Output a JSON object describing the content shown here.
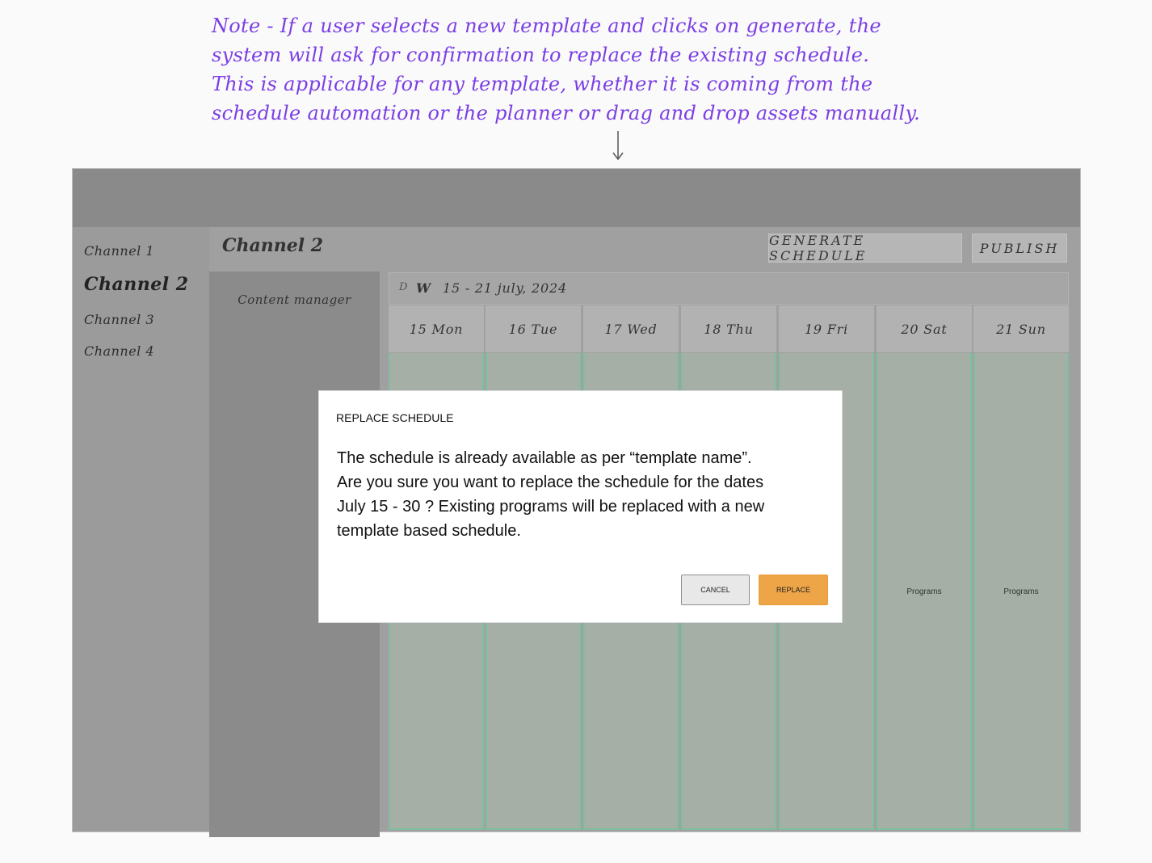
{
  "note": {
    "lines": [
      "Note - If a user selects a new template and clicks on generate, the",
      "system will ask for confirmation to replace the existing schedule.",
      "This is applicable for any template, whether it is coming from the",
      "schedule automation or the planner or drag and drop assets manually."
    ],
    "color": "#7b3fe4"
  },
  "sidebar": {
    "channels": [
      "Channel 1",
      "Channel 2",
      "Channel 3",
      "Channel 4"
    ],
    "active": "Channel 2"
  },
  "main": {
    "title": "Channel 2",
    "generate_label": "GENERATE SCHEDULE",
    "publish_label": "PUBLISH",
    "content_manager_label": "Content manager"
  },
  "schedule": {
    "view_d": "D",
    "view_w": "W",
    "range": "15 - 21 july, 2024",
    "days": [
      "15 Mon",
      "16 Tue",
      "17 Wed",
      "18 Thu",
      "19 Fri",
      "20 Sat",
      "21 Sun"
    ],
    "program_label": "Programs"
  },
  "dialog": {
    "title": "REPLACE SCHEDULE",
    "body_lines": [
      "The schedule is already available as per “template name”.",
      "Are you sure you want to replace the schedule for the dates",
      "July 15 - 30 ? Existing programs will be replaced with a new",
      "template based schedule."
    ],
    "cancel_label": "CANCEL",
    "replace_label": "REPLACE",
    "accent_color": "#eea548"
  }
}
